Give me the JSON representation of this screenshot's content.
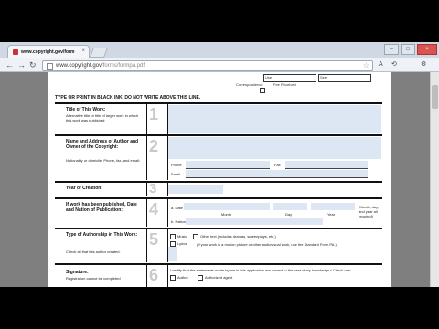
{
  "browser": {
    "tab_title": "www.copyright.gov/form",
    "url_host": "www.copyright.gov",
    "url_path": "/forms/formpa.pdf",
    "close_symbol": "×",
    "win_min": "–",
    "win_max": "□",
    "win_close": "×",
    "back": "←",
    "forward": "→",
    "reload": "↻",
    "star": "☆",
    "tool1": "A",
    "tool2": "⟲",
    "tool3": "⚙"
  },
  "form": {
    "top_fields": {
      "use": "Use",
      "see": "See",
      "correspondence": "Correspondence",
      "fee_received": "Fee Received"
    },
    "header": "TYPE OR PRINT IN BLACK INK. DO NOT WRITE ABOVE THIS LINE.",
    "sections": {
      "s1": {
        "num": "1",
        "title": "Title of This Work:",
        "note": "Alternative title or title of larger work in which this work was published:"
      },
      "s2": {
        "num": "2",
        "title": "Name and Address of Author and Owner of the Copyright:",
        "note": "Nationality or domicile: Phone, fax, and email:",
        "phone": "Phone",
        "fax": "Fax",
        "email": "Email"
      },
      "s3": {
        "num": "3",
        "title": "Year of Creation:"
      },
      "s4": {
        "num": "4",
        "title": "If work has been published, Date and Nation of Publication:",
        "date_label": "a. Date",
        "month": "Month",
        "day": "Day",
        "year": "Year",
        "nation": "b. Nation",
        "side_note": "(Month, day, and year all required)"
      },
      "s5": {
        "num": "5",
        "title": "Type of Authorship in This Work:",
        "note": "Check all that this author created.",
        "music": "Music",
        "lyrics": "Lyrics",
        "other_text": "Other text (includes dramas, screenplays, etc.)",
        "other_note": "(If your work is a motion picture or other audiovisual work, use the Standard Form PA.)"
      },
      "s6": {
        "num": "6",
        "title": "Signature:",
        "note": "Registration cannot be completed",
        "certify": "I certify that the statements made by me in this application are correct to the best of my knowledge.* Check one:",
        "author": "Author",
        "agent": "Authorized agent"
      }
    }
  }
}
